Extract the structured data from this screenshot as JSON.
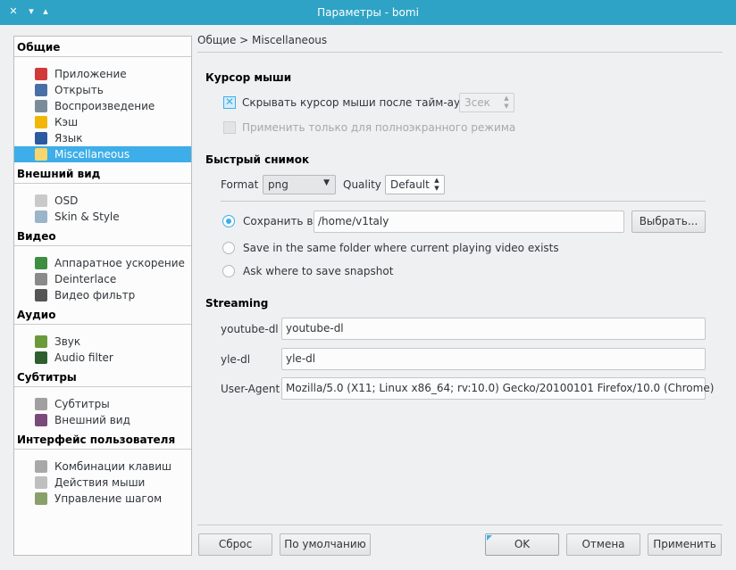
{
  "window": {
    "title": "Параметры - bomi"
  },
  "sidebar": {
    "groups": [
      {
        "title": "Общие",
        "items": [
          {
            "label": "Приложение",
            "icon": "app-icon",
            "color": "#d23a3a"
          },
          {
            "label": "Открыть",
            "icon": "folder-open-icon",
            "color": "#4a6fa5"
          },
          {
            "label": "Воспроизведение",
            "icon": "play-icon",
            "color": "#7b8b9a"
          },
          {
            "label": "Кэш",
            "icon": "cache-icon",
            "color": "#f2b705"
          },
          {
            "label": "Язык",
            "icon": "language-icon",
            "color": "#2c5aa0"
          },
          {
            "label": "Miscellaneous",
            "icon": "misc-icon",
            "color": "#f5d76e"
          }
        ]
      },
      {
        "title": "Внешний вид",
        "items": [
          {
            "label": "OSD",
            "icon": "osd-icon",
            "color": "#c9c9c9"
          },
          {
            "label": "Skin & Style",
            "icon": "skin-icon",
            "color": "#9ab4c8"
          }
        ]
      },
      {
        "title": "Видео",
        "items": [
          {
            "label": "Аппаратное ускорение",
            "icon": "hardware-icon",
            "color": "#3e8e41"
          },
          {
            "label": "Deinterlace",
            "icon": "deinterlace-icon",
            "color": "#8a8a8a"
          },
          {
            "label": "Видео фильтр",
            "icon": "filter-icon",
            "color": "#555555"
          }
        ]
      },
      {
        "title": "Аудио",
        "items": [
          {
            "label": "Звук",
            "icon": "speaker-icon",
            "color": "#6a9a3a"
          },
          {
            "label": "Audio filter",
            "icon": "audio-filter-icon",
            "color": "#2f5f2f"
          }
        ]
      },
      {
        "title": "Субтитры",
        "items": [
          {
            "label": "Субтитры",
            "icon": "subtitles-icon",
            "color": "#a0a0a0"
          },
          {
            "label": "Внешний вид",
            "icon": "text-style-icon",
            "color": "#7a4a7a"
          }
        ]
      },
      {
        "title": "Интерфейс пользователя",
        "items": [
          {
            "label": "Комбинации клавиш",
            "icon": "keyboard-icon",
            "color": "#a8a8a8"
          },
          {
            "label": "Действия мыши",
            "icon": "mouse-icon",
            "color": "#bfbfbf"
          },
          {
            "label": "Управление шагом",
            "icon": "step-icon",
            "color": "#8aa06a"
          }
        ]
      }
    ]
  },
  "main": {
    "breadcrumb": "Общие > Miscellaneous",
    "cursor": {
      "heading": "Курсор мыши",
      "hide_label": "Скрывать курсор мыши после тайм-аута:",
      "hide_checked": true,
      "timeout_value": "3сек",
      "fullscreen_only_label": "Применить только для полноэкранного режима",
      "fullscreen_only_checked": false
    },
    "snapshot": {
      "heading": "Быстрый снимок",
      "format_label": "Format",
      "format_value": "png",
      "quality_label": "Quality",
      "quality_value": "Default",
      "save_in_label": "Сохранить в",
      "save_in_path": "/home/v1taly",
      "browse_button": "Выбрать...",
      "same_folder_label": "Save in the same folder where current playing video exists",
      "ask_label": "Ask where to save snapshot",
      "selected_option": "save_in"
    },
    "streaming": {
      "heading": "Streaming",
      "youtube_label": "youtube-dl",
      "youtube_value": "youtube-dl",
      "yle_label": "yle-dl",
      "yle_value": "yle-dl",
      "ua_label": "User-Agent",
      "ua_value": "Mozilla/5.0 (X11; Linux x86_64; rv:10.0) Gecko/20100101 Firefox/10.0 (Chrome)"
    }
  },
  "footer": {
    "reset": "Сброс",
    "defaults": "По умолчанию",
    "ok": "OK",
    "cancel": "Отмена",
    "apply": "Применить"
  },
  "colors": {
    "accent": "#3daee9",
    "titlebar": "#2ea3c6"
  }
}
